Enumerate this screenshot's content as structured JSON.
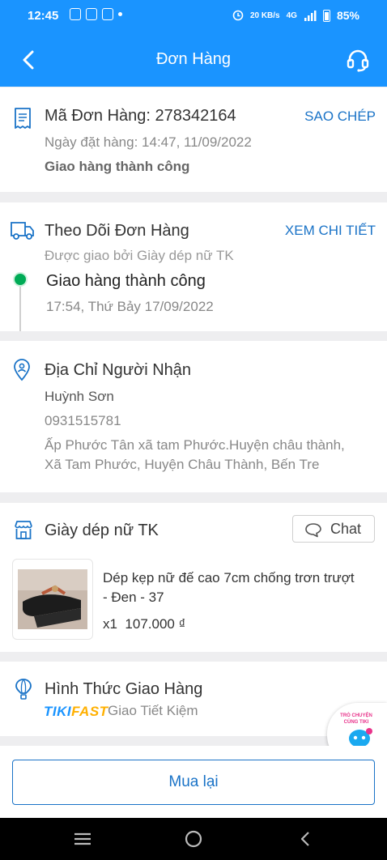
{
  "status_bar": {
    "time": "12:45",
    "network_speed": "20 KB/s",
    "signal": "4G",
    "battery": "85%"
  },
  "header": {
    "title": "Đơn Hàng"
  },
  "order": {
    "code_label": "Mã Đơn Hàng: 278342164",
    "copy_label": "SAO CHÉP",
    "date": "Ngày đặt hàng: 14:47, 11/09/2022",
    "status": "Giao hàng thành công"
  },
  "tracking": {
    "title": "Theo Dõi Đơn Hàng",
    "detail_label": "XEM CHI TIẾT",
    "delivered_by": "Được giao bởi Giày dép nữ TK",
    "status": "Giao hàng thành công",
    "time": "17:54, Thứ Bảy 17/09/2022"
  },
  "address": {
    "title": "Địa Chỉ Người Nhận",
    "name": "Huỳnh Sơn",
    "phone": "0931515781",
    "line1": "Ấp Phước Tân xã tam Phước.Huyện châu thành,",
    "line2": "Xã Tam Phước, Huyện Châu Thành, Bến Tre"
  },
  "shop": {
    "name": "Giày dép nữ TK",
    "chat_label": "Chat"
  },
  "product": {
    "name_line1": "Dép kẹp nữ đế cao 7cm chống trơn trượt",
    "name_line2": "- Đen - 37",
    "quantity": "x1",
    "price": "107.000 ₫"
  },
  "shipping": {
    "title": "Hình Thức Giao Hàng",
    "brand_tiki": "TIKI",
    "brand_fast": "FAST",
    "method": "Giao Tiết Kiệm"
  },
  "chat_bubble": {
    "line1": "TRÒ CHUYỆN",
    "line2": "CÙNG TIKI"
  },
  "footer": {
    "rebuy_label": "Mua lại"
  },
  "colors": {
    "primary": "#1a94ff",
    "link": "#1a73c7",
    "success": "#00ab56"
  }
}
